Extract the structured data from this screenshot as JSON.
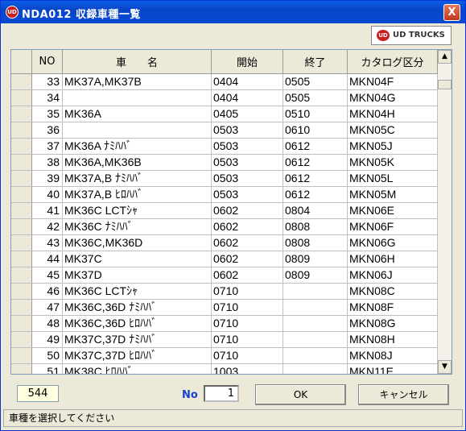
{
  "window": {
    "title": "NDA012 収録車種一覧",
    "icon": "ud-logo-icon",
    "close": "X"
  },
  "logo": {
    "mark": "UD",
    "text": "UD TRUCKS"
  },
  "table": {
    "columns": [
      "NO",
      "車　　名",
      "開始",
      "終了",
      "カタログ区分"
    ],
    "rows": [
      [
        "33",
        "MK37A,MK37B",
        "0404",
        "0505",
        "MKN04F"
      ],
      [
        "34",
        "",
        "0404",
        "0505",
        "MKN04G"
      ],
      [
        "35",
        "MK36A",
        "0405",
        "0510",
        "MKN04H"
      ],
      [
        "36",
        "",
        "0503",
        "0610",
        "MKN05C"
      ],
      [
        "37",
        "MK36A ﾅﾐﾊﾊﾞ",
        "0503",
        "0612",
        "MKN05J"
      ],
      [
        "38",
        "MK36A,MK36B",
        "0503",
        "0612",
        "MKN05K"
      ],
      [
        "39",
        "MK37A,B ﾅﾐﾊﾊﾞ",
        "0503",
        "0612",
        "MKN05L"
      ],
      [
        "40",
        "MK37A,B ﾋﾛﾊﾊﾞ",
        "0503",
        "0612",
        "MKN05M"
      ],
      [
        "41",
        "MK36C LCTｼｬ",
        "0602",
        "0804",
        "MKN06E"
      ],
      [
        "42",
        "MK36C ﾅﾐﾊﾊﾞ",
        "0602",
        "0808",
        "MKN06F"
      ],
      [
        "43",
        "MK36C,MK36D",
        "0602",
        "0808",
        "MKN06G"
      ],
      [
        "44",
        "MK37C",
        "0602",
        "0809",
        "MKN06H"
      ],
      [
        "45",
        "MK37D",
        "0602",
        "0809",
        "MKN06J"
      ],
      [
        "46",
        "MK36C LCTｼｬ",
        "0710",
        "",
        "MKN08C"
      ],
      [
        "47",
        "MK36C,36D ﾅﾐﾊﾊﾞ",
        "0710",
        "",
        "MKN08F"
      ],
      [
        "48",
        "MK36C,36D ﾋﾛﾊﾊﾞ",
        "0710",
        "",
        "MKN08G"
      ],
      [
        "49",
        "MK37C,37D ﾅﾐﾊﾊﾞ",
        "0710",
        "",
        "MKN08H"
      ],
      [
        "50",
        "MK37C,37D ﾋﾛﾊﾊﾞ",
        "0710",
        "",
        "MKN08J"
      ],
      [
        "51",
        "MK38C ﾋﾛﾊﾊﾞ",
        "1003",
        "",
        "MKN11E"
      ]
    ]
  },
  "scroll": {
    "up": "▲",
    "down": "▼"
  },
  "footer": {
    "count": "544",
    "no_label": "No",
    "no_value": "1",
    "ok": "OK",
    "cancel": "キャンセル"
  },
  "status": "車種を選択してください"
}
